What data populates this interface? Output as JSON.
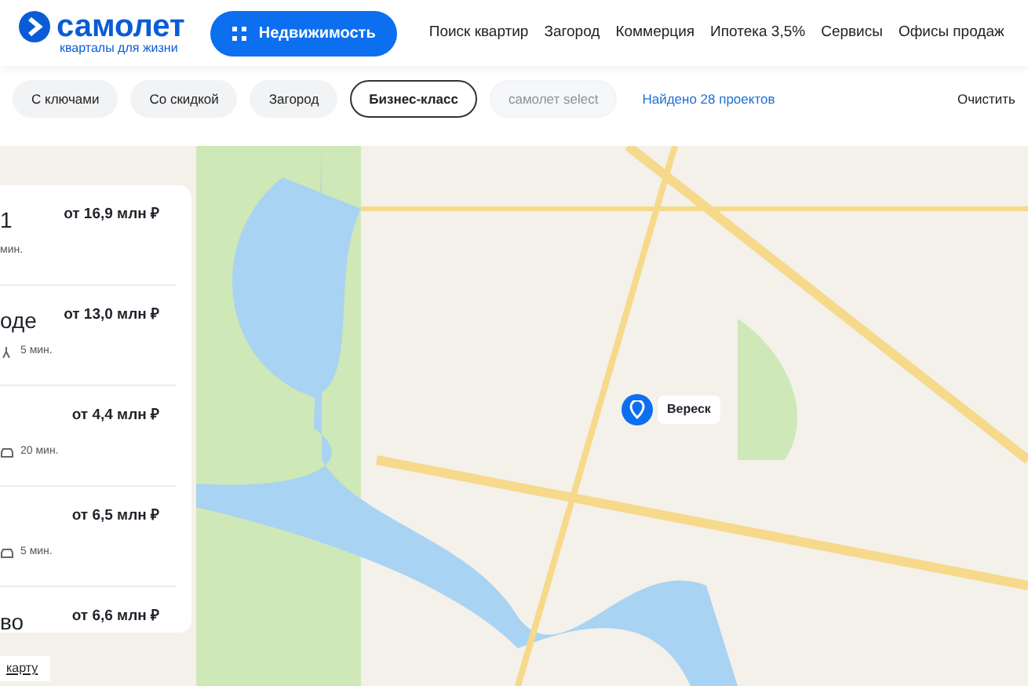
{
  "header": {
    "logo": {
      "name": "самолет",
      "tagline": "кварталы для жизни"
    },
    "primary_button": "Недвижимость",
    "nav": [
      "Поиск квартир",
      "Загород",
      "Коммерция",
      "Ипотека 3,5%",
      "Сервисы",
      "Офисы продаж"
    ]
  },
  "filters": [
    {
      "label": "С ключами",
      "selected": false,
      "disabled": false
    },
    {
      "label": "Со скидкой",
      "selected": false,
      "disabled": false
    },
    {
      "label": "Загород",
      "selected": false,
      "disabled": false
    },
    {
      "label": "Бизнес-класс",
      "selected": true,
      "disabled": false
    },
    {
      "label": "самолет select",
      "selected": false,
      "disabled": true
    }
  ],
  "found": "Найдено 28 проектов",
  "clear": "Очистить",
  "projects": [
    {
      "title": "1",
      "price": "от 16,9 млн ₽",
      "travel": "мин."
    },
    {
      "title": "оде",
      "price": "от 13,0 млн ₽",
      "travel": "5 мин.",
      "kind": "walk"
    },
    {
      "price": "от 4,4 млн ₽",
      "travel": "20 мин.",
      "kind": "car"
    },
    {
      "price": "от 6,5 млн ₽",
      "travel": "5 мин.",
      "kind": "car"
    },
    {
      "title": "во",
      "price": "от 6,6 млн ₽"
    }
  ],
  "map": {
    "pin": "Вереск",
    "link": "карту"
  }
}
